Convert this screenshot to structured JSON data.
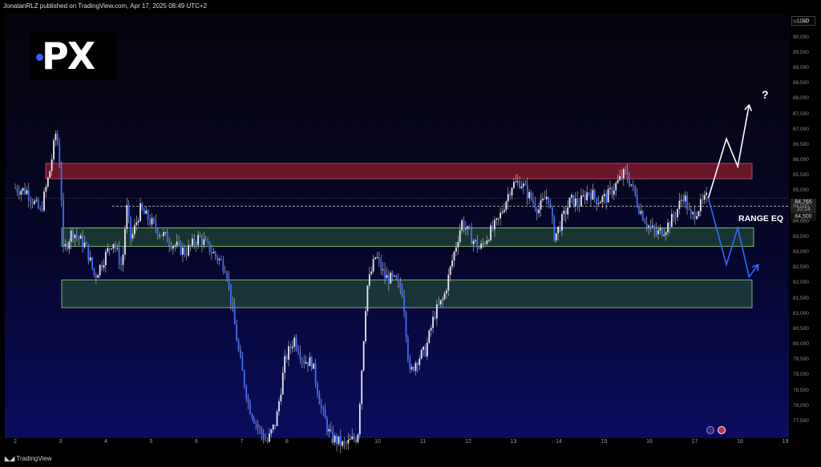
{
  "header": {
    "published": "JonatanRLZ published on TradingView.com, Apr 17, 2025 08:49 UTC+2"
  },
  "footer": {
    "brand": "TradingView",
    "brand_icon": "tradingview-logo-icon"
  },
  "logo": {
    "text": "PX",
    "dot_color": "#3b5bff"
  },
  "price_axis": {
    "currency": "USD",
    "ticks": [
      "90,500",
      "90,000",
      "89,500",
      "89,000",
      "88,500",
      "88,000",
      "87,500",
      "87,000",
      "86,500",
      "86,000",
      "85,500",
      "85,000",
      "84,500",
      "84,000",
      "83,500",
      "83,000",
      "82,500",
      "82,000",
      "81,500",
      "81,000",
      "80,500",
      "80,000",
      "79,500",
      "79,000",
      "78,500",
      "78,000",
      "77,500"
    ],
    "last_price": "84,765",
    "countdown": "10:14",
    "range_eq_price": "84,500"
  },
  "annotations": {
    "range_eq": "RANGE EQ",
    "question": "?"
  },
  "colors": {
    "candle": "#3d6bff",
    "wick": "#ffffff",
    "resistance_zone": "#8b1c2c",
    "support_zone": "#2a5b3c",
    "bull_path": "#ffffff",
    "bear_path": "#2f6bff"
  },
  "chart_data": {
    "type": "candlestick",
    "x_ticks": [
      "2",
      "3",
      "4",
      "5",
      "6",
      "7",
      "8",
      "9",
      "10",
      "11",
      "12",
      "13",
      "14",
      "15",
      "16",
      "17",
      "18",
      "19"
    ],
    "ylim": [
      77000,
      90700
    ],
    "grid": false,
    "zones": [
      {
        "name": "resistance",
        "from": 85400,
        "to": 85900
      },
      {
        "name": "support-upper",
        "from": 83200,
        "to": 83800
      },
      {
        "name": "support-lower",
        "from": 81200,
        "to": 82100
      }
    ],
    "range_eq_level": 84500,
    "last_price": 84765,
    "price_path": [
      [
        2.0,
        85100
      ],
      [
        2.3,
        85000
      ],
      [
        2.6,
        84300
      ],
      [
        2.8,
        85600
      ],
      [
        2.95,
        87000
      ],
      [
        3.05,
        85400
      ],
      [
        3.1,
        83000
      ],
      [
        3.3,
        83700
      ],
      [
        3.6,
        83200
      ],
      [
        3.8,
        82200
      ],
      [
        4.0,
        82800
      ],
      [
        4.2,
        83400
      ],
      [
        4.4,
        82500
      ],
      [
        4.5,
        84500
      ],
      [
        4.6,
        83400
      ],
      [
        4.8,
        84400
      ],
      [
        5.2,
        83700
      ],
      [
        5.5,
        83300
      ],
      [
        5.8,
        83000
      ],
      [
        6.1,
        83500
      ],
      [
        6.4,
        83000
      ],
      [
        6.7,
        82500
      ],
      [
        6.85,
        81000
      ],
      [
        7.0,
        79500
      ],
      [
        7.2,
        78000
      ],
      [
        7.4,
        77300
      ],
      [
        7.6,
        76800
      ],
      [
        7.8,
        77500
      ],
      [
        8.0,
        79500
      ],
      [
        8.2,
        80200
      ],
      [
        8.4,
        79500
      ],
      [
        8.6,
        79400
      ],
      [
        8.8,
        77900
      ],
      [
        9.0,
        77000
      ],
      [
        9.3,
        76700
      ],
      [
        9.6,
        77000
      ],
      [
        9.8,
        81800
      ],
      [
        10.0,
        82900
      ],
      [
        10.2,
        82200
      ],
      [
        10.4,
        82100
      ],
      [
        10.6,
        81700
      ],
      [
        10.75,
        79000
      ],
      [
        10.9,
        79500
      ],
      [
        11.1,
        79800
      ],
      [
        11.3,
        81000
      ],
      [
        11.5,
        81500
      ],
      [
        11.7,
        82800
      ],
      [
        11.9,
        84000
      ],
      [
        12.1,
        83500
      ],
      [
        12.3,
        83100
      ],
      [
        12.5,
        83600
      ],
      [
        12.7,
        84000
      ],
      [
        12.85,
        84600
      ],
      [
        13.0,
        85200
      ],
      [
        13.2,
        85300
      ],
      [
        13.4,
        84800
      ],
      [
        13.6,
        84400
      ],
      [
        13.8,
        84900
      ],
      [
        13.95,
        83500
      ],
      [
        14.1,
        84000
      ],
      [
        14.3,
        84700
      ],
      [
        14.5,
        84600
      ],
      [
        14.7,
        85000
      ],
      [
        14.9,
        84700
      ],
      [
        15.1,
        84800
      ],
      [
        15.3,
        85200
      ],
      [
        15.5,
        85600
      ],
      [
        15.65,
        85200
      ],
      [
        15.8,
        84500
      ],
      [
        16.0,
        83900
      ],
      [
        16.2,
        83600
      ],
      [
        16.4,
        83800
      ],
      [
        16.6,
        84200
      ],
      [
        16.8,
        84900
      ],
      [
        16.95,
        84100
      ],
      [
        17.1,
        84400
      ],
      [
        17.3,
        84765
      ]
    ],
    "projection_up": [
      [
        17.3,
        84765
      ],
      [
        17.7,
        86700
      ],
      [
        17.95,
        85800
      ],
      [
        18.2,
        87800
      ]
    ],
    "projection_down": [
      [
        17.3,
        84765
      ],
      [
        17.7,
        82600
      ],
      [
        17.95,
        83800
      ],
      [
        18.2,
        82200
      ],
      [
        18.4,
        82600
      ]
    ]
  }
}
